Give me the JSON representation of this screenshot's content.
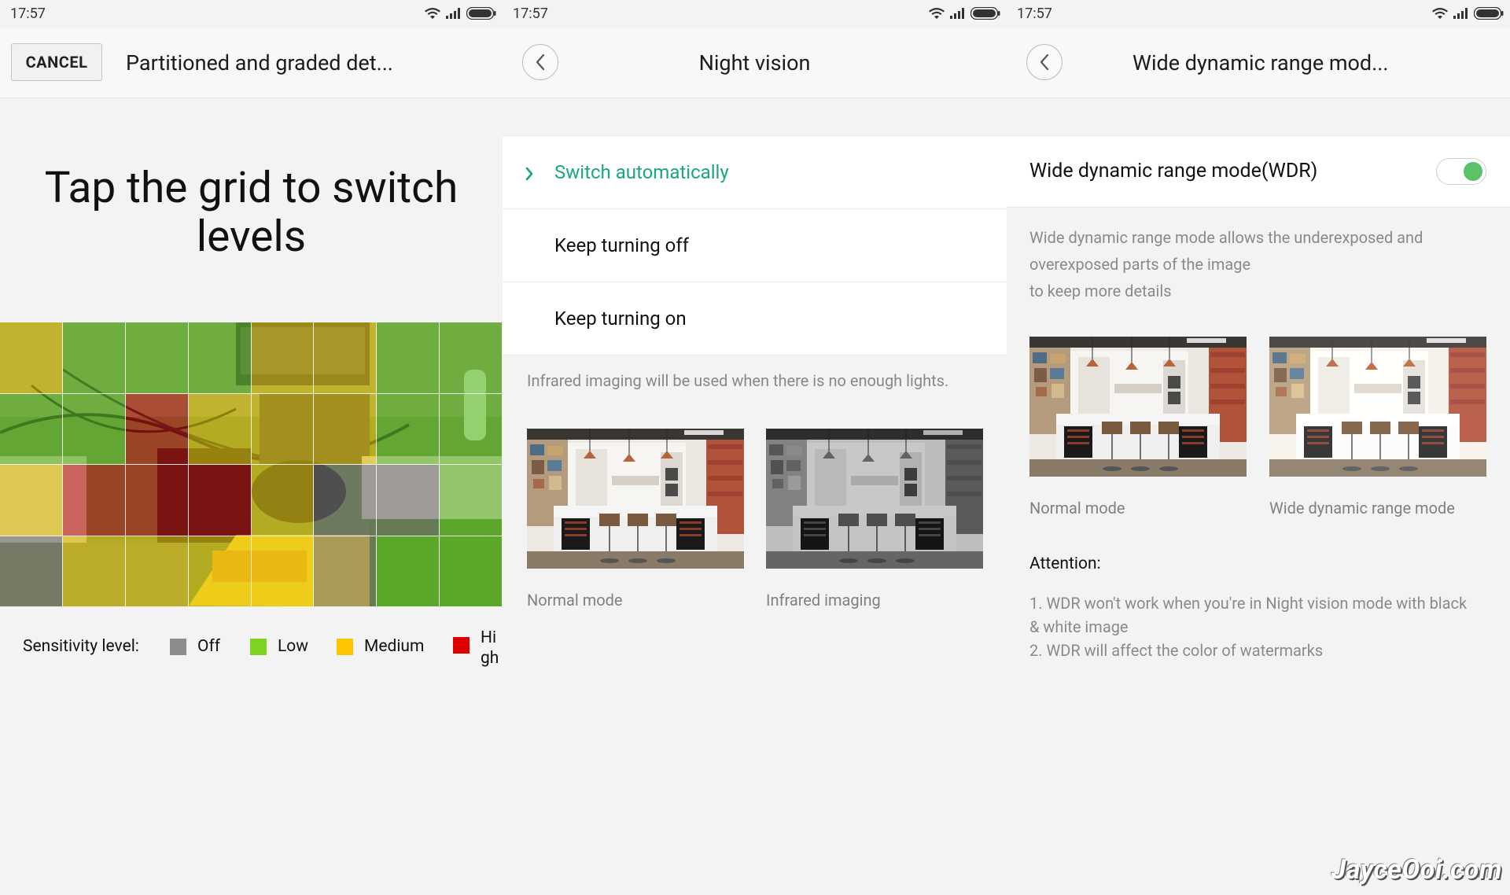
{
  "status_time": "17:57",
  "panel1": {
    "cancel_label": "CANCEL",
    "header_title": "Partitioned and graded det...",
    "instruction_line1": "Tap the grid to switch",
    "instruction_line2": "levels",
    "grid_levels": [
      [
        "medium",
        "low",
        "low",
        "low",
        "medium",
        "medium",
        "low",
        "low"
      ],
      [
        "low",
        "low",
        "high",
        "medium",
        "medium",
        "medium",
        "low",
        "low"
      ],
      [
        "medium",
        "high",
        "high",
        "high",
        "medium",
        "off",
        "off",
        "low"
      ],
      [
        "off",
        "medium",
        "medium",
        "medium",
        "medium",
        "off",
        "low",
        "low"
      ]
    ],
    "legend": {
      "label": "Sensitivity level:",
      "items": [
        {
          "label": "Off",
          "color": "#8c8c8c"
        },
        {
          "label": "Low",
          "color": "#7ed321"
        },
        {
          "label": "Medium",
          "color": "#ffc400"
        },
        {
          "label": "High",
          "color": "#e00000"
        }
      ]
    }
  },
  "panel2": {
    "header_title": "Night vision",
    "options": [
      {
        "label": "Switch automatically",
        "selected": true
      },
      {
        "label": "Keep turning off",
        "selected": false
      },
      {
        "label": "Keep turning on",
        "selected": false
      }
    ],
    "hint": "Infrared imaging will be used when there is no enough lights.",
    "normal_caption": "Normal mode",
    "infrared_caption": "Infrared imaging"
  },
  "panel3": {
    "header_title": "Wide dynamic range mod...",
    "wdr_label": "Wide dynamic range mode(WDR)",
    "wdr_enabled": true,
    "description": [
      "Wide dynamic range mode allows the underexposed and",
      "overexposed parts of the image",
      "to keep more details"
    ],
    "normal_caption": "Normal mode",
    "wdr_caption": "Wide dynamic range mode",
    "attention_label": "Attention:",
    "notes": [
      "1. WDR won't work when you're in Night vision mode with black",
      "& white image",
      "2. WDR will affect the color of watermarks"
    ]
  },
  "watermark": "JayceOoi.com",
  "colors": {
    "accent_green": "#19a77f",
    "toggle_green": "#5cc16b"
  }
}
